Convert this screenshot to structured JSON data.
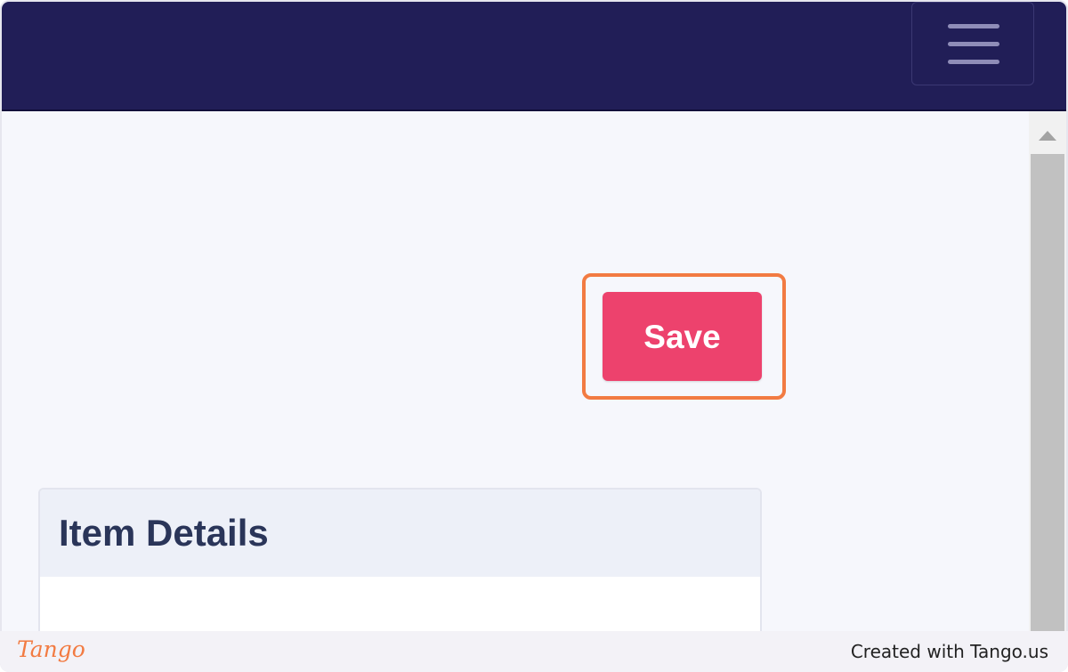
{
  "header": {
    "menu_toggle_icon": "hamburger-menu-icon"
  },
  "main": {
    "save_label": "Save",
    "card": {
      "title": "Item Details"
    }
  },
  "scrollbar": {
    "up_arrow_icon": "scroll-up-arrow-icon"
  },
  "footer": {
    "logo_text": "Tango",
    "credit": "Created with Tango.us"
  },
  "colors": {
    "header_bg": "#211e57",
    "save_button": "#ed426d",
    "highlight": "#f27b42",
    "card_title": "#2a3559",
    "page_bg": "#f6f7fc"
  }
}
